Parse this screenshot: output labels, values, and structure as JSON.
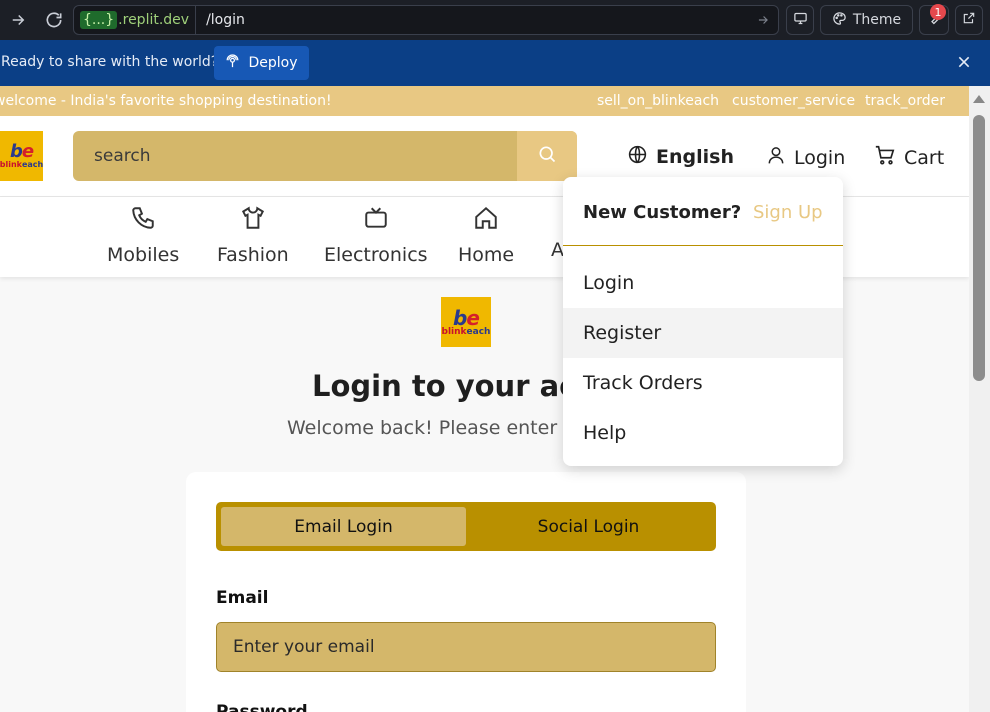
{
  "browser": {
    "url_braces": "{...}",
    "url_domain": ".replit.dev",
    "url_path": "/login",
    "theme_label": "Theme",
    "notification_count": "1"
  },
  "deploy_banner": {
    "text": "Ready to share with the world?",
    "button_label": "Deploy"
  },
  "promo": {
    "text": "welcome - India's favorite shopping destination!",
    "links": [
      "sell_on_blinkeach",
      "customer_service",
      "track_order"
    ]
  },
  "brand": {
    "logo_mark_1": "b",
    "logo_mark_2": "e",
    "logo_word_1": "blink",
    "logo_word_2": "each"
  },
  "header": {
    "search_placeholder": "search",
    "language": "English",
    "login_label": "Login",
    "cart_label": "Cart"
  },
  "categories": [
    {
      "label": "Mobiles",
      "icon": "phone-icon"
    },
    {
      "label": "Fashion",
      "icon": "shirt-icon"
    },
    {
      "label": "Electronics",
      "icon": "tv-icon"
    },
    {
      "label": "Home",
      "icon": "home-icon"
    },
    {
      "label": "A",
      "icon": ""
    }
  ],
  "login": {
    "title": "Login to your acco",
    "subtitle": "Welcome back! Please enter you",
    "tabs": [
      "Email Login",
      "Social Login"
    ],
    "email_label": "Email",
    "email_placeholder": "Enter your email",
    "password_label": "Password"
  },
  "dropdown": {
    "new_customer": "New Customer?",
    "sign_up": "Sign Up",
    "items": [
      "Login",
      "Register",
      "Track Orders",
      "Help"
    ]
  },
  "colors": {
    "gold": "#e8c883",
    "dark_gold": "#b99000",
    "banner_blue": "#0b3f86"
  }
}
